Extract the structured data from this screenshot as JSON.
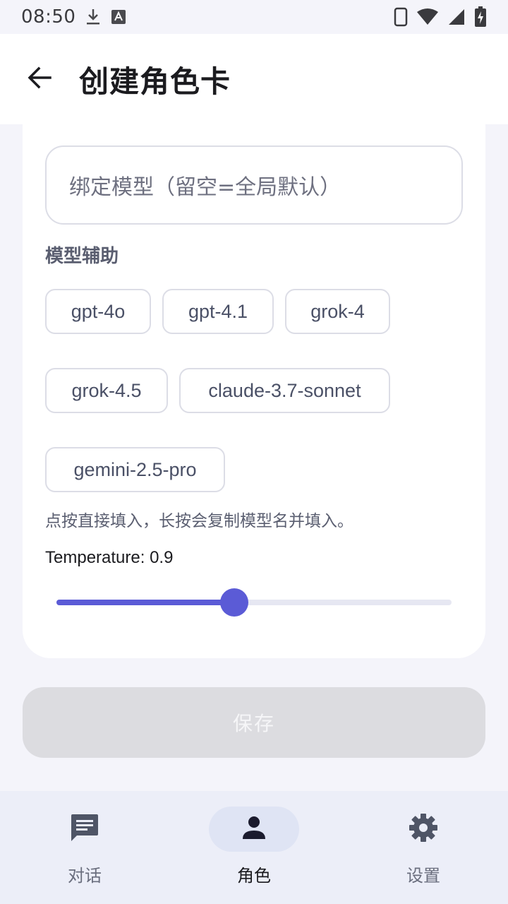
{
  "status_bar": {
    "time": "08:50",
    "icons": [
      "download-icon",
      "a-icon",
      "phone-icon",
      "wifi-icon",
      "signal-icon",
      "battery-charging-icon"
    ]
  },
  "header": {
    "title": "创建角色卡",
    "back_icon": "arrow-back-icon"
  },
  "form": {
    "model_input": {
      "value": "",
      "placeholder": "绑定模型（留空=全局默认）"
    },
    "model_assist_label": "模型辅助",
    "model_chips": [
      "gpt-4o",
      "gpt-4.1",
      "grok-4",
      "grok-4.5",
      "claude-3.7-sonnet",
      "gemini-2.5-pro"
    ],
    "hint": "点按直接填入，长按会复制模型名并填入。",
    "temperature_label": "Temperature: 0.9",
    "temperature": {
      "value": 0.9,
      "min": 0,
      "max": 2
    }
  },
  "save_button": {
    "label": "保存",
    "enabled": false
  },
  "bottom_nav": {
    "items": [
      {
        "label": "对话",
        "icon": "chat-icon",
        "active": false
      },
      {
        "label": "角色",
        "icon": "person-icon",
        "active": true
      },
      {
        "label": "设置",
        "icon": "gear-icon",
        "active": false
      }
    ]
  },
  "colors": {
    "accent": "#5b5bd6",
    "background": "#f4f4fa",
    "surface": "#ffffff",
    "disabled_button": "#dcdce0",
    "nav_background": "#eceef8",
    "nav_active_pill": "#dfe4f4"
  }
}
